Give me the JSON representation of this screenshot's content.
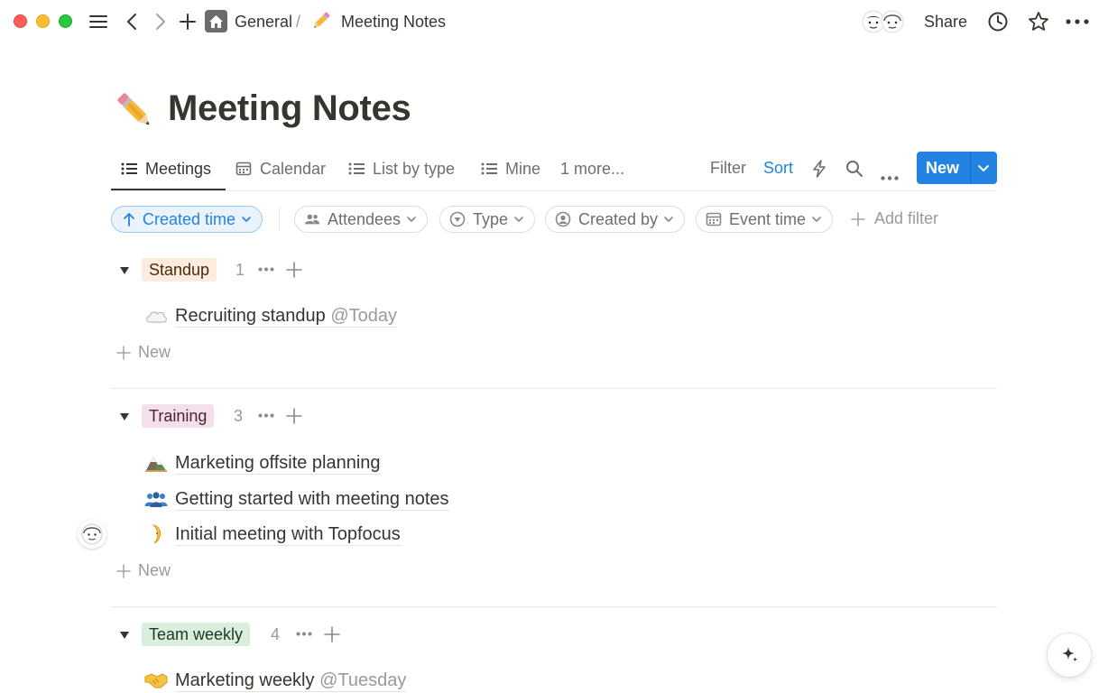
{
  "window": {
    "breadcrumb": {
      "workspace": "General",
      "separator": "/",
      "page": "Meeting Notes"
    },
    "share_label": "Share"
  },
  "page": {
    "title": "Meeting Notes",
    "icon": "pencil-icon"
  },
  "views": {
    "tabs": [
      {
        "label": "Meetings",
        "icon": "list-icon",
        "active": true
      },
      {
        "label": "Calendar",
        "icon": "calendar-icon",
        "active": false
      },
      {
        "label": "List by type",
        "icon": "list-icon",
        "active": false
      },
      {
        "label": "Mine",
        "icon": "list-icon",
        "active": false
      }
    ],
    "more_label": "1 more...",
    "filter_label": "Filter",
    "sort_label": "Sort",
    "new_label": "New"
  },
  "filters": {
    "sort_chip": "Created time",
    "chips": [
      {
        "label": "Attendees",
        "icon": "people-icon"
      },
      {
        "label": "Type",
        "icon": "select-icon"
      },
      {
        "label": "Created by",
        "icon": "person-icon"
      },
      {
        "label": "Event time",
        "icon": "calendar-icon"
      }
    ],
    "add_filter_label": "Add filter"
  },
  "groups": [
    {
      "name": "Standup",
      "count": "1",
      "items": [
        {
          "title": "Recruiting standup",
          "date": "@Today",
          "icon": "cloud-icon"
        }
      ]
    },
    {
      "name": "Training",
      "count": "3",
      "items": [
        {
          "title": "Marketing offsite planning",
          "date": "",
          "icon": "mountain-icon"
        },
        {
          "title": "Getting started with meeting notes",
          "date": "",
          "icon": "people-icon"
        },
        {
          "title": "Initial meeting with Topfocus",
          "date": "",
          "icon": "moon-icon"
        }
      ]
    },
    {
      "name": "Team weekly",
      "count": "4",
      "items": [
        {
          "title": "Marketing weekly",
          "date": "@Tuesday",
          "icon": "handshake-icon"
        }
      ]
    }
  ],
  "new_row_label": "New",
  "colors": {
    "accent": "#2383e2",
    "text": "#37352f",
    "muted": "#9b9a97",
    "standup_tag": "#fbecdd",
    "training_tag": "#f4dfeb",
    "weekly_tag": "#dbeddb"
  }
}
